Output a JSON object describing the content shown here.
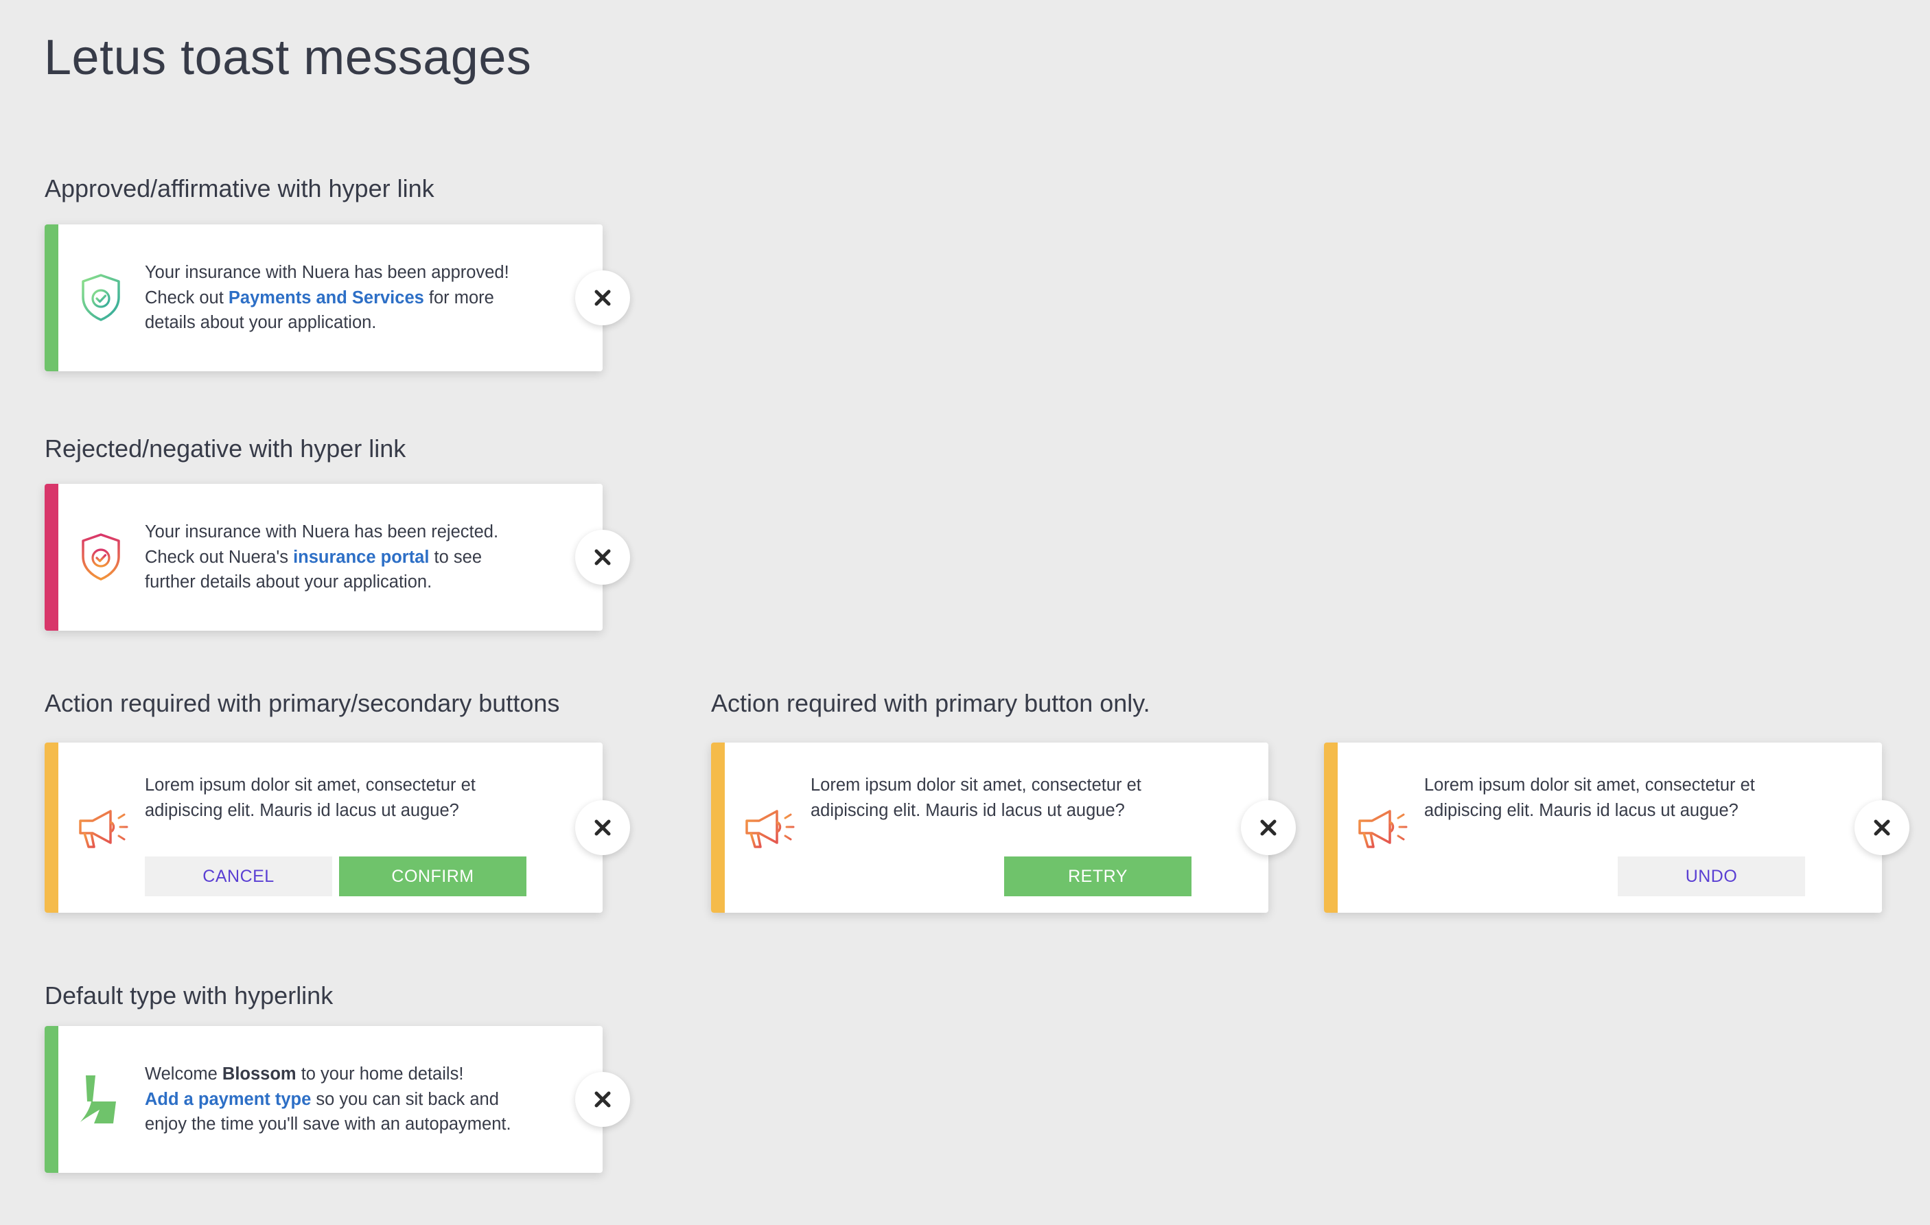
{
  "page": {
    "title": "Letus toast messages"
  },
  "colors": {
    "success": "#6fc36b",
    "error": "#d8366a",
    "warning": "#f5bb4a",
    "link": "#2d6fc6",
    "secondary_text": "#5a3fd3",
    "background": "#ebebeb"
  },
  "sections": {
    "approved": {
      "title": "Approved/affirmative with hyper link",
      "icon": "shield-check-icon",
      "message": {
        "line1": "Your insurance with Nuera has been approved!",
        "pre_link": "Check out ",
        "link": "Payments and Services",
        "post_link": " for more",
        "line3": "details about your application."
      },
      "close_icon": "close-icon"
    },
    "rejected": {
      "title": "Rejected/negative with hyper link",
      "icon": "shield-check-icon",
      "message": {
        "line1": "Your insurance with Nuera has been rejected.",
        "pre_link": "Check out Nuera's ",
        "link": "insurance portal",
        "post_link": " to see",
        "line3": "further details about your application."
      },
      "close_icon": "close-icon"
    },
    "action_two_buttons": {
      "title": "Action required with primary/secondary buttons",
      "icon": "megaphone-icon",
      "message": {
        "line1": "Lorem ipsum dolor sit amet, consectetur et",
        "line2": "adipiscing elit. Mauris id lacus ut augue?"
      },
      "secondary_label": "CANCEL",
      "primary_label": "CONFIRM",
      "close_icon": "close-icon"
    },
    "action_primary_only": {
      "title": "Action required with primary button only.",
      "toasts": [
        {
          "icon": "megaphone-icon",
          "message": {
            "line1": "Lorem ipsum dolor sit amet, consectetur et",
            "line2": "adipiscing elit. Mauris id lacus ut augue?"
          },
          "button_label": "RETRY",
          "button_style": "primary"
        },
        {
          "icon": "megaphone-icon",
          "message": {
            "line1": "Lorem ipsum dolor sit amet, consectetur et",
            "line2": "adipiscing elit. Mauris id lacus ut augue?"
          },
          "button_label": "UNDO",
          "button_style": "secondary"
        }
      ]
    },
    "default": {
      "title": "Default type with hyperlink",
      "icon": "letus-logo-icon",
      "message": {
        "pre_bold": "Welcome ",
        "bold": "Blossom",
        "post_bold": " to your home details!",
        "link": "Add a payment type",
        "post_link": " so you can sit back and",
        "line3": "enjoy the time you'll save with an autopayment."
      },
      "close_icon": "close-icon"
    }
  }
}
